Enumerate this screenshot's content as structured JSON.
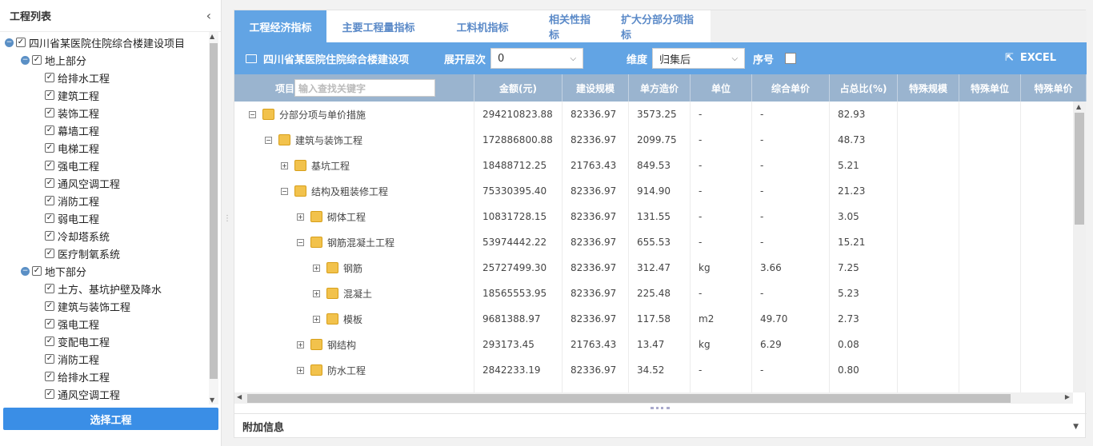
{
  "sidebar": {
    "title": "工程列表",
    "collapse_icon": "chevron-left-icon",
    "tree": [
      {
        "label": "四川省某医院住院综合楼建设项目",
        "level": 0,
        "expanded": true
      },
      {
        "label": "地上部分",
        "level": 1,
        "expanded": true
      },
      {
        "label": "给排水工程",
        "level": 2
      },
      {
        "label": "建筑工程",
        "level": 2
      },
      {
        "label": "装饰工程",
        "level": 2
      },
      {
        "label": "幕墙工程",
        "level": 2
      },
      {
        "label": "电梯工程",
        "level": 2
      },
      {
        "label": "强电工程",
        "level": 2
      },
      {
        "label": "通风空调工程",
        "level": 2
      },
      {
        "label": "消防工程",
        "level": 2
      },
      {
        "label": "弱电工程",
        "level": 2
      },
      {
        "label": "冷却塔系统",
        "level": 2
      },
      {
        "label": "医疗制氧系统",
        "level": 2
      },
      {
        "label": "地下部分",
        "level": 1,
        "expanded": true
      },
      {
        "label": "土方、基坑护壁及降水",
        "level": 2
      },
      {
        "label": "建筑与装饰工程",
        "level": 2
      },
      {
        "label": "强电工程",
        "level": 2
      },
      {
        "label": "变配电工程",
        "level": 2
      },
      {
        "label": "消防工程",
        "level": 2
      },
      {
        "label": "给排水工程",
        "level": 2
      },
      {
        "label": "通风空调工程",
        "level": 2
      }
    ],
    "select_button": "选择工程"
  },
  "tabs": [
    "工程经济指标",
    "主要工程量指标",
    "工料机指标",
    "相关性指标",
    "扩大分部分项指标"
  ],
  "active_tab": 0,
  "toolbar": {
    "project_name": "四川省某医院住院综合楼建设项",
    "expand_level_label": "展开层次",
    "expand_level_value": "0",
    "dimension_label": "维度",
    "dimension_value": "归集后",
    "serial_label": "序号",
    "excel_label": "EXCEL"
  },
  "grid": {
    "search_placeholder": "输入查找关键字",
    "headers": [
      "项目",
      "金额(元)",
      "建设规模",
      "单方造价",
      "单位",
      "综合单价",
      "占总比(%)",
      "特殊规模",
      "特殊单位",
      "特殊单价"
    ],
    "rows": [
      {
        "depth": 0,
        "toggle": "−",
        "name": "分部分项与单价措施",
        "amount": "294210823.88",
        "scale": "82336.97",
        "unit_cost": "3573.25",
        "unit": "-",
        "price": "-",
        "ratio": "82.93"
      },
      {
        "depth": 1,
        "toggle": "−",
        "name": "建筑与装饰工程",
        "amount": "172886800.88",
        "scale": "82336.97",
        "unit_cost": "2099.75",
        "unit": "-",
        "price": "-",
        "ratio": "48.73"
      },
      {
        "depth": 2,
        "toggle": "+",
        "name": "基坑工程",
        "amount": "18488712.25",
        "scale": "21763.43",
        "unit_cost": "849.53",
        "unit": "-",
        "price": "-",
        "ratio": "5.21"
      },
      {
        "depth": 2,
        "toggle": "−",
        "name": "结构及粗装修工程",
        "amount": "75330395.40",
        "scale": "82336.97",
        "unit_cost": "914.90",
        "unit": "-",
        "price": "-",
        "ratio": "21.23"
      },
      {
        "depth": 3,
        "toggle": "+",
        "name": "砌体工程",
        "amount": "10831728.15",
        "scale": "82336.97",
        "unit_cost": "131.55",
        "unit": "-",
        "price": "-",
        "ratio": "3.05"
      },
      {
        "depth": 3,
        "toggle": "−",
        "name": "钢筋混凝土工程",
        "amount": "53974442.22",
        "scale": "82336.97",
        "unit_cost": "655.53",
        "unit": "-",
        "price": "-",
        "ratio": "15.21"
      },
      {
        "depth": 4,
        "toggle": "+",
        "name": "钢筋",
        "amount": "25727499.30",
        "scale": "82336.97",
        "unit_cost": "312.47",
        "unit": "kg",
        "price": "3.66",
        "ratio": "7.25"
      },
      {
        "depth": 4,
        "toggle": "+",
        "name": "混凝土",
        "amount": "18565553.95",
        "scale": "82336.97",
        "unit_cost": "225.48",
        "unit": "-",
        "price": "-",
        "ratio": "5.23"
      },
      {
        "depth": 4,
        "toggle": "+",
        "name": "模板",
        "amount": "9681388.97",
        "scale": "82336.97",
        "unit_cost": "117.58",
        "unit": "m2",
        "price": "49.70",
        "ratio": "2.73"
      },
      {
        "depth": 3,
        "toggle": "+",
        "name": "钢结构",
        "amount": "293173.45",
        "scale": "21763.43",
        "unit_cost": "13.47",
        "unit": "kg",
        "price": "6.29",
        "ratio": "0.08"
      },
      {
        "depth": 3,
        "toggle": "+",
        "name": "防水工程",
        "amount": "2842233.19",
        "scale": "82336.97",
        "unit_cost": "34.52",
        "unit": "-",
        "price": "-",
        "ratio": "0.80"
      }
    ]
  },
  "extra_info_label": "附加信息"
}
